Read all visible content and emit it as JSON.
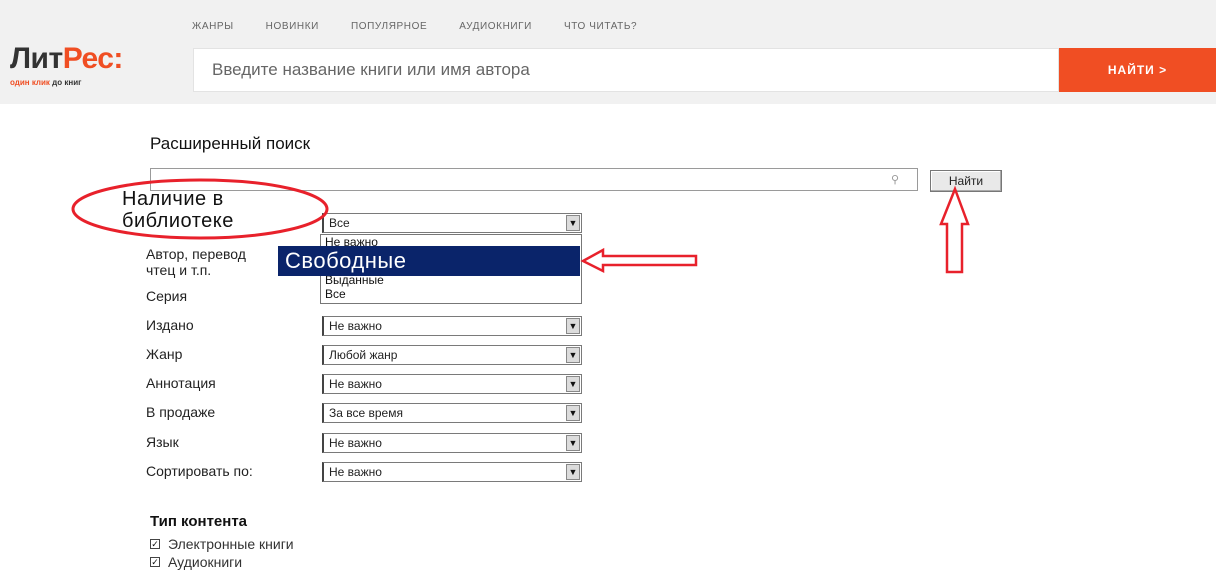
{
  "header": {
    "nav": [
      "ЖАНРЫ",
      "НОВИНКИ",
      "ПОПУЛЯРНОЕ",
      "АУДИОКНИГИ",
      "ЧТО ЧИТАТЬ?"
    ],
    "logo_left": "Лит",
    "logo_right": "Рес:",
    "tagline_orange": "один клик",
    "tagline_dark": "до книг",
    "search_placeholder": "Введите название книги или имя автора",
    "find_label": "НАЙТИ >"
  },
  "advanced": {
    "title": "Расширенный поиск",
    "find_label": "Найти",
    "availability_label_line1": "Наличие в",
    "availability_label_line2": "библиотеке",
    "availability_value": "Все",
    "author_label_line1": "Автор, перевод",
    "author_label_line2": "чтец и т.п.",
    "dropdown_options": [
      "Не важно",
      "Свободные",
      "Выданные",
      "Все"
    ],
    "dropdown_highlighted": "Свободные",
    "fields": [
      {
        "label": "Серия",
        "value": ""
      },
      {
        "label": "Издано",
        "value": "Не важно"
      },
      {
        "label": "Жанр",
        "value": "Любой жанр"
      },
      {
        "label": "Аннотация",
        "value": "Не важно"
      },
      {
        "label": "В продаже",
        "value": "За все время"
      },
      {
        "label": "Язык",
        "value": "Не важно"
      },
      {
        "label": "Сортировать по:",
        "value": "Не важно"
      }
    ]
  },
  "content_type": {
    "title": "Тип контента",
    "options": [
      "Электронные книги",
      "Аудиокниги"
    ]
  },
  "colors": {
    "accent": "#f04e23",
    "annotation": "#e8212b",
    "selection": "#0a246a"
  },
  "icons": [
    "magnifier-icon",
    "dropdown-arrow-icon",
    "checkbox-icon"
  ]
}
